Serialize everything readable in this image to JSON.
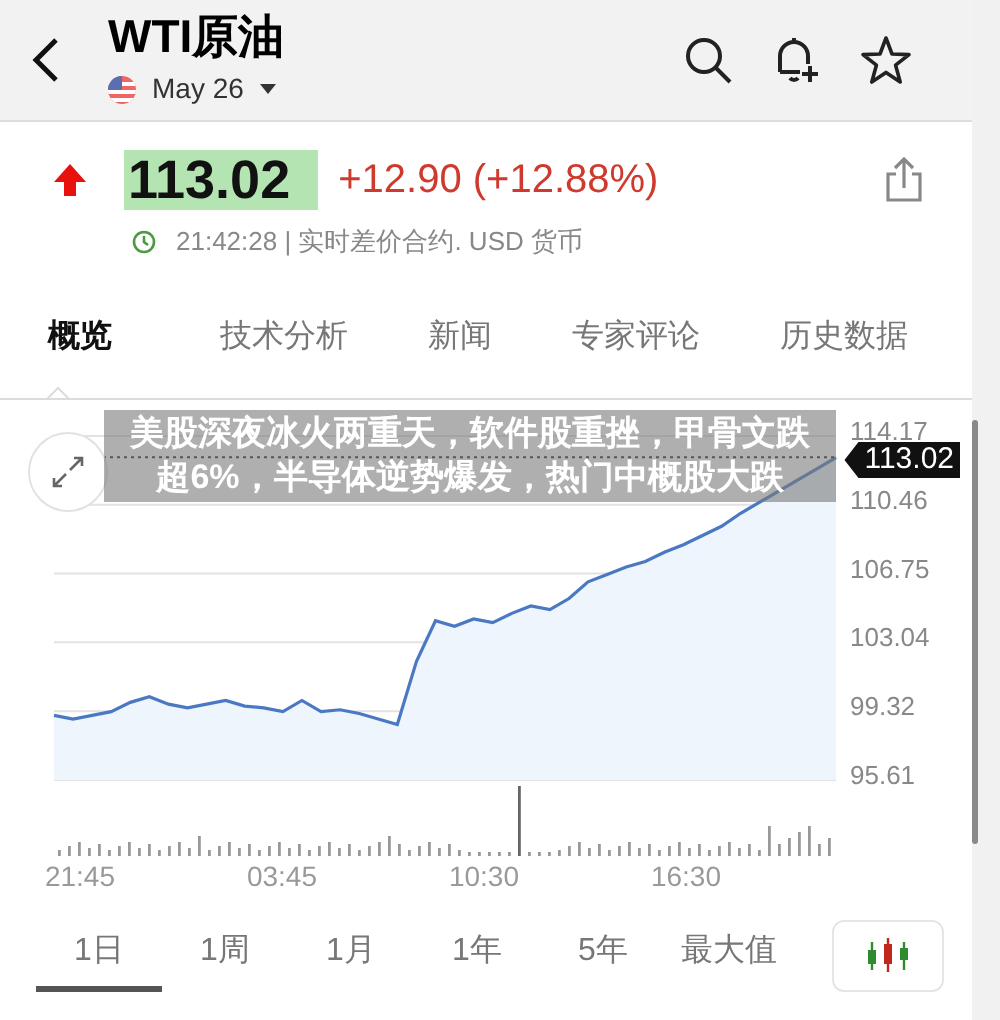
{
  "header": {
    "title": "WTI原油",
    "date": "May 26"
  },
  "quote": {
    "rising": true,
    "price": "113.02",
    "change": "+12.90 (+12.88%)",
    "time_info": "21:42:28 | 实时差价合约. USD 货币"
  },
  "tabs": [
    {
      "label": "概览",
      "selected": true
    },
    {
      "label": "技术分析",
      "selected": false
    },
    {
      "label": "新闻",
      "selected": false
    },
    {
      "label": "专家评论",
      "selected": false
    },
    {
      "label": "历史数据",
      "selected": false
    }
  ],
  "chart": {
    "headline": "美股深夜冰火两重天，软件股重挫，甲骨文跌超6%，半导体逆势爆发，热门中概股大跌",
    "time_labels": [
      "21:45",
      "03:45",
      "10:30",
      "16:30"
    ],
    "chart_data": {
      "type": "area",
      "grid": true,
      "ylim": [
        95.61,
        114.17
      ],
      "ref_lines": [
        {
          "axis": "y",
          "value": 113.02,
          "label": "113.02"
        }
      ],
      "yticks": [
        {
          "value": 114.17,
          "label": "114.17"
        },
        {
          "value": 110.46,
          "label": "110.46"
        },
        {
          "value": 106.75,
          "label": "106.75"
        },
        {
          "value": 103.04,
          "label": "103.04"
        },
        {
          "value": 99.32,
          "label": "99.32"
        },
        {
          "value": 95.61,
          "label": "95.61"
        }
      ],
      "series": [
        {
          "color": "#4a78c2",
          "values": [
            99.1,
            98.9,
            99.1,
            99.3,
            99.8,
            100.1,
            99.7,
            99.5,
            99.7,
            99.9,
            99.6,
            99.5,
            99.3,
            99.9,
            99.3,
            99.4,
            99.2,
            98.9,
            98.6,
            102.0,
            104.2,
            103.9,
            104.3,
            104.1,
            104.6,
            105.0,
            104.8,
            105.4,
            106.3,
            106.7,
            107.1,
            107.4,
            107.9,
            108.3,
            108.8,
            109.3,
            110.0,
            null,
            null,
            null,
            null,
            113.0
          ]
        }
      ]
    }
  },
  "periods": [
    {
      "label": "1日",
      "selected": true
    },
    {
      "label": "1周",
      "selected": false
    },
    {
      "label": "1月",
      "selected": false
    },
    {
      "label": "1年",
      "selected": false
    },
    {
      "label": "5年",
      "selected": false
    },
    {
      "label": "最大值",
      "selected": false
    }
  ]
}
